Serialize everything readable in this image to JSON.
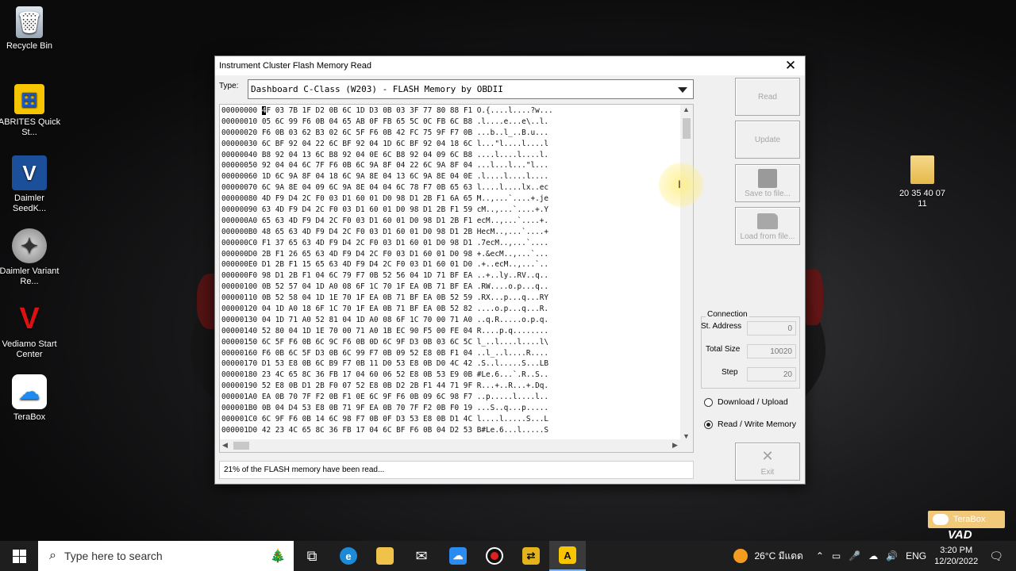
{
  "desktop": {
    "icons": [
      {
        "label": "Recycle Bin",
        "icon": "recycle-bin-icon"
      },
      {
        "label": "ABRITES Quick St...",
        "icon": "abrites-icon"
      },
      {
        "label": "Daimler SeedK...",
        "icon": "daimler-seedkey-icon"
      },
      {
        "label": "Daimler Variant Re...",
        "icon": "mercedes-star-icon"
      },
      {
        "label": "Vediamo Start Center",
        "icon": "vediamo-icon"
      },
      {
        "label": "TeraBox",
        "icon": "terabox-icon"
      }
    ],
    "folder": {
      "label": "20 35 40 07 11",
      "icon": "folder-icon"
    },
    "terabox_badge": "TeraBox",
    "watermark": "VAD"
  },
  "window": {
    "title": "Instrument Cluster Flash Memory Read",
    "type_label": "Type:",
    "type_value": "Dashboard C-Class (W203) - FLASH Memory by OBDII",
    "hex_lines": [
      {
        "addr": "00000000",
        "bytes": "4F 03 7B 1F D2 0B 6C 1D D3 0B 03 3F 77 80 88 F1",
        "ascii": "O.{....l....?w..."
      },
      {
        "addr": "00000010",
        "bytes": "05 6C 99 F6 0B 04 65 AB 0F FB 65 5C 0C FB 6C B8",
        "ascii": ".l....e...e\\..l."
      },
      {
        "addr": "00000020",
        "bytes": "F6 0B 03 62 B3 02 6C 5F F6 0B 42 FC 75 9F F7 0B",
        "ascii": "...b..l_..B.u..."
      },
      {
        "addr": "00000030",
        "bytes": "6C BF 92 04 22 6C BF 92 04 1D 6C BF 92 04 18 6C",
        "ascii": "l...\"l....l....l"
      },
      {
        "addr": "00000040",
        "bytes": "B8 92 04 13 6C B8 92 04 0E 6C B8 92 04 09 6C B8",
        "ascii": "....l....l....l."
      },
      {
        "addr": "00000050",
        "bytes": "92 04 04 6C 7F F6 0B 6C 9A 8F 04 22 6C 9A 8F 04",
        "ascii": "...l...l...\"l..."
      },
      {
        "addr": "00000060",
        "bytes": "1D 6C 9A 8F 04 18 6C 9A 8E 04 13 6C 9A 8E 04 0E",
        "ascii": ".l....l....l...."
      },
      {
        "addr": "00000070",
        "bytes": "6C 9A 8E 04 09 6C 9A 8E 04 04 6C 78 F7 0B 65 63",
        "ascii": "l....l....lx..ec"
      },
      {
        "addr": "00000080",
        "bytes": "4D F9 D4 2C F0 03 D1 60 01 D0 98 D1 2B F1 6A 65",
        "ascii": "M..,...`....+.je"
      },
      {
        "addr": "00000090",
        "bytes": "63 4D F9 D4 2C F0 03 D1 60 01 D0 98 D1 2B F1 59",
        "ascii": "cM..,...`....+.Y"
      },
      {
        "addr": "000000A0",
        "bytes": "65 63 4D F9 D4 2C F0 03 D1 60 01 D0 98 D1 2B F1",
        "ascii": "ecM..,...`....+."
      },
      {
        "addr": "000000B0",
        "bytes": "48 65 63 4D F9 D4 2C F0 03 D1 60 01 D0 98 D1 2B",
        "ascii": "HecM..,...`....+"
      },
      {
        "addr": "000000C0",
        "bytes": "F1 37 65 63 4D F9 D4 2C F0 03 D1 60 01 D0 98 D1",
        "ascii": ".7ecM..,...`...."
      },
      {
        "addr": "000000D0",
        "bytes": "2B F1 26 65 63 4D F9 D4 2C F0 03 D1 60 01 D0 98",
        "ascii": "+.&ecM..,...`..."
      },
      {
        "addr": "000000E0",
        "bytes": "D1 2B F1 15 65 63 4D F9 D4 2C F0 03 D1 60 01 D0",
        "ascii": ".+..ecM..,...`.."
      },
      {
        "addr": "000000F0",
        "bytes": "98 D1 2B F1 04 6C 79 F7 0B 52 56 04 1D 71 BF EA",
        "ascii": "..+..ly..RV..q.."
      },
      {
        "addr": "00000100",
        "bytes": "0B 52 57 04 1D A0 08 6F 1C 70 1F EA 0B 71 BF EA",
        "ascii": ".RW....o.p...q.."
      },
      {
        "addr": "00000110",
        "bytes": "0B 52 58 04 1D 1E 70 1F EA 0B 71 BF EA 0B 52 59",
        "ascii": ".RX...p...q...RY"
      },
      {
        "addr": "00000120",
        "bytes": "04 1D A0 18 6F 1C 70 1F EA 0B 71 BF EA 0B 52 82",
        "ascii": "....o.p...q...R."
      },
      {
        "addr": "00000130",
        "bytes": "04 1D 71 A0 52 81 04 1D A0 08 6F 1C 70 00 71 A0",
        "ascii": "..q.R.....o.p.q."
      },
      {
        "addr": "00000140",
        "bytes": "52 80 04 1D 1E 70 00 71 A0 1B EC 90 F5 00 FE 04",
        "ascii": "R....p.q........"
      },
      {
        "addr": "00000150",
        "bytes": "6C 5F F6 0B 6C 9C F6 0B 0D 6C 9F D3 0B 03 6C 5C",
        "ascii": "l_..l....l....l\\"
      },
      {
        "addr": "00000160",
        "bytes": "F6 0B 6C 5F D3 0B 6C 99 F7 0B 09 52 E8 0B F1 04",
        "ascii": "..l_..l....R...."
      },
      {
        "addr": "00000170",
        "bytes": "D1 53 E8 0B 6C B9 F7 0B 11 D0 53 E8 0B D0 4C 42",
        "ascii": ".S..l.....S...LB"
      },
      {
        "addr": "00000180",
        "bytes": "23 4C 65 8C 36 FB 17 04 60 06 52 E8 0B 53 E9 0B",
        "ascii": "#Le.6...`.R..S.."
      },
      {
        "addr": "00000190",
        "bytes": "52 E8 0B D1 2B F0 07 52 E8 0B D2 2B F1 44 71 9F",
        "ascii": "R...+..R...+.Dq."
      },
      {
        "addr": "000001A0",
        "bytes": "EA 0B 70 7F F2 0B F1 0E 6C 9F F6 0B 09 6C 98 F7",
        "ascii": "..p.....l....l.."
      },
      {
        "addr": "000001B0",
        "bytes": "0B 04 D4 53 E8 0B 71 9F EA 0B 70 7F F2 0B F0 19",
        "ascii": "...S..q...p....."
      },
      {
        "addr": "000001C0",
        "bytes": "6C 9F F6 0B 14 6C 98 F7 0B 0F D3 53 E8 0B D1 4C",
        "ascii": "l....l.....S...L"
      },
      {
        "addr": "000001D0",
        "bytes": "42 23 4C 65 8C 36 FB 17 04 6C BF F6 0B 04 D2 53",
        "ascii": "B#Le.6...l.....S"
      }
    ],
    "status_text": "21% of the FLASH memory have been read...",
    "progress_percent": 21,
    "buttons": {
      "read": "Read",
      "update": "Update",
      "save": "Save to file...",
      "load": "Load from file...",
      "exit": "Exit"
    },
    "connection": {
      "title": "Connection",
      "st_address_label": "St. Address",
      "st_address_value": "0",
      "total_size_label": "Total Size",
      "total_size_value": "10020",
      "step_label": "Step",
      "step_value": "20"
    },
    "modes": {
      "download_upload": "Download / Upload",
      "read_write": "Read / Write Memory",
      "selected": "read_write"
    }
  },
  "taskbar": {
    "search_placeholder": "Type here to search",
    "weather": "26°C มีแดด",
    "language": "ENG",
    "time": "3:20 PM",
    "date": "12/20/2022"
  }
}
